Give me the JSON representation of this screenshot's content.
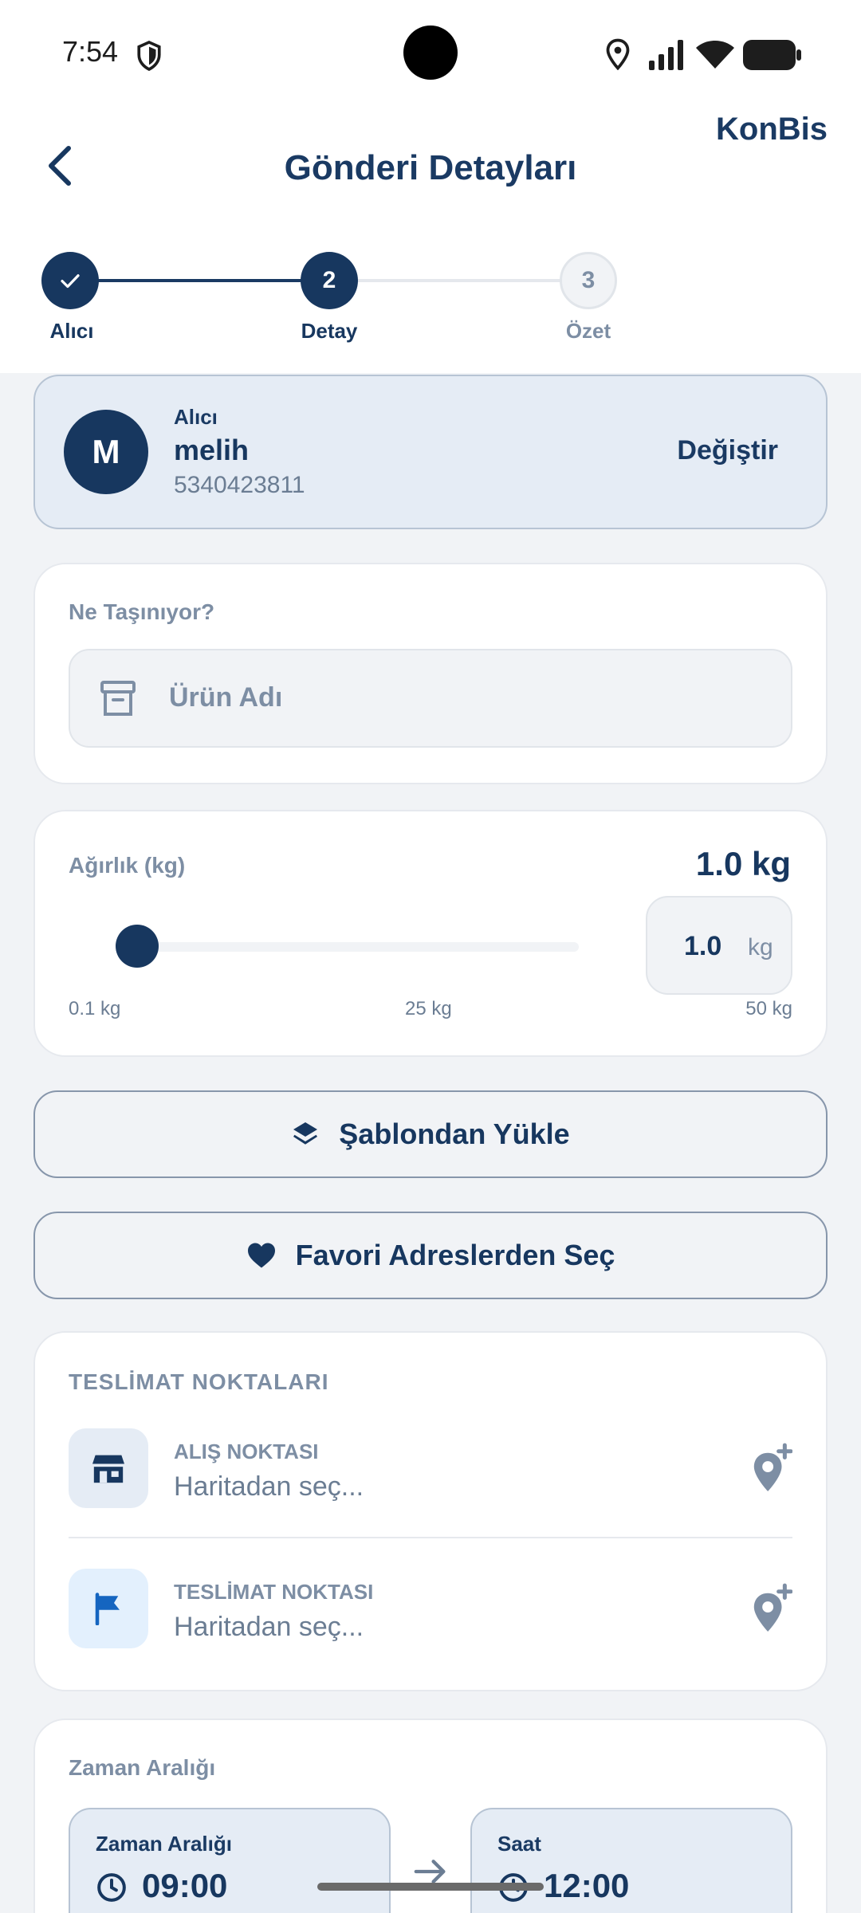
{
  "status_bar": {
    "time": "7:54"
  },
  "header": {
    "brand": "KonBis",
    "title": "Gönderi Detayları"
  },
  "stepper": {
    "steps": [
      {
        "number": "1",
        "label": "Alıcı",
        "state": "done"
      },
      {
        "number": "2",
        "label": "Detay",
        "state": "active"
      },
      {
        "number": "3",
        "label": "Özet",
        "state": "todo"
      }
    ]
  },
  "recipient": {
    "avatar_letter": "M",
    "label": "Alıcı",
    "name": "melih",
    "phone": "5340423811",
    "change_label": "Değiştir"
  },
  "what": {
    "label": "Ne Taşınıyor?",
    "placeholder": "Ürün Adı"
  },
  "weight": {
    "label": "Ağırlık (kg)",
    "display": "1.0 kg",
    "input_value": "1.0",
    "unit": "kg",
    "min_label": "0.1 kg",
    "mid_label": "25 kg",
    "max_label": "50 kg",
    "slider_value": 1.0,
    "slider_min": 0.1,
    "slider_max": 50
  },
  "buttons": {
    "template": "Şablondan Yükle",
    "favorites": "Favori Adreslerden Seç"
  },
  "delivery_points": {
    "title": "TESLİMAT NOKTALARI",
    "pickup": {
      "title": "ALIŞ NOKTASI",
      "placeholder": "Haritadan seç..."
    },
    "dropoff": {
      "title": "TESLİMAT NOKTASI",
      "placeholder": "Haritadan seç..."
    }
  },
  "time_range": {
    "title": "Zaman Aralığı",
    "start": {
      "label": "Zaman Aralığı",
      "value": "09:00"
    },
    "end": {
      "label": "Saat",
      "value": "12:00"
    }
  },
  "colors": {
    "primary": "#17375f",
    "muted": "#7d8ea4",
    "background": "#f1f3f6",
    "selected_card": "#e5ecf5",
    "dropoff_icon": "#1565c0"
  },
  "icons": {
    "back": "chevron-left-icon",
    "check": "check-icon",
    "product": "archive-box-icon",
    "template": "layers-icon",
    "favorites": "heart-icon",
    "pickup": "store-icon",
    "dropoff": "flag-icon",
    "add_location": "add-location-icon",
    "clock": "clock-icon",
    "arrow": "arrow-right-icon"
  }
}
